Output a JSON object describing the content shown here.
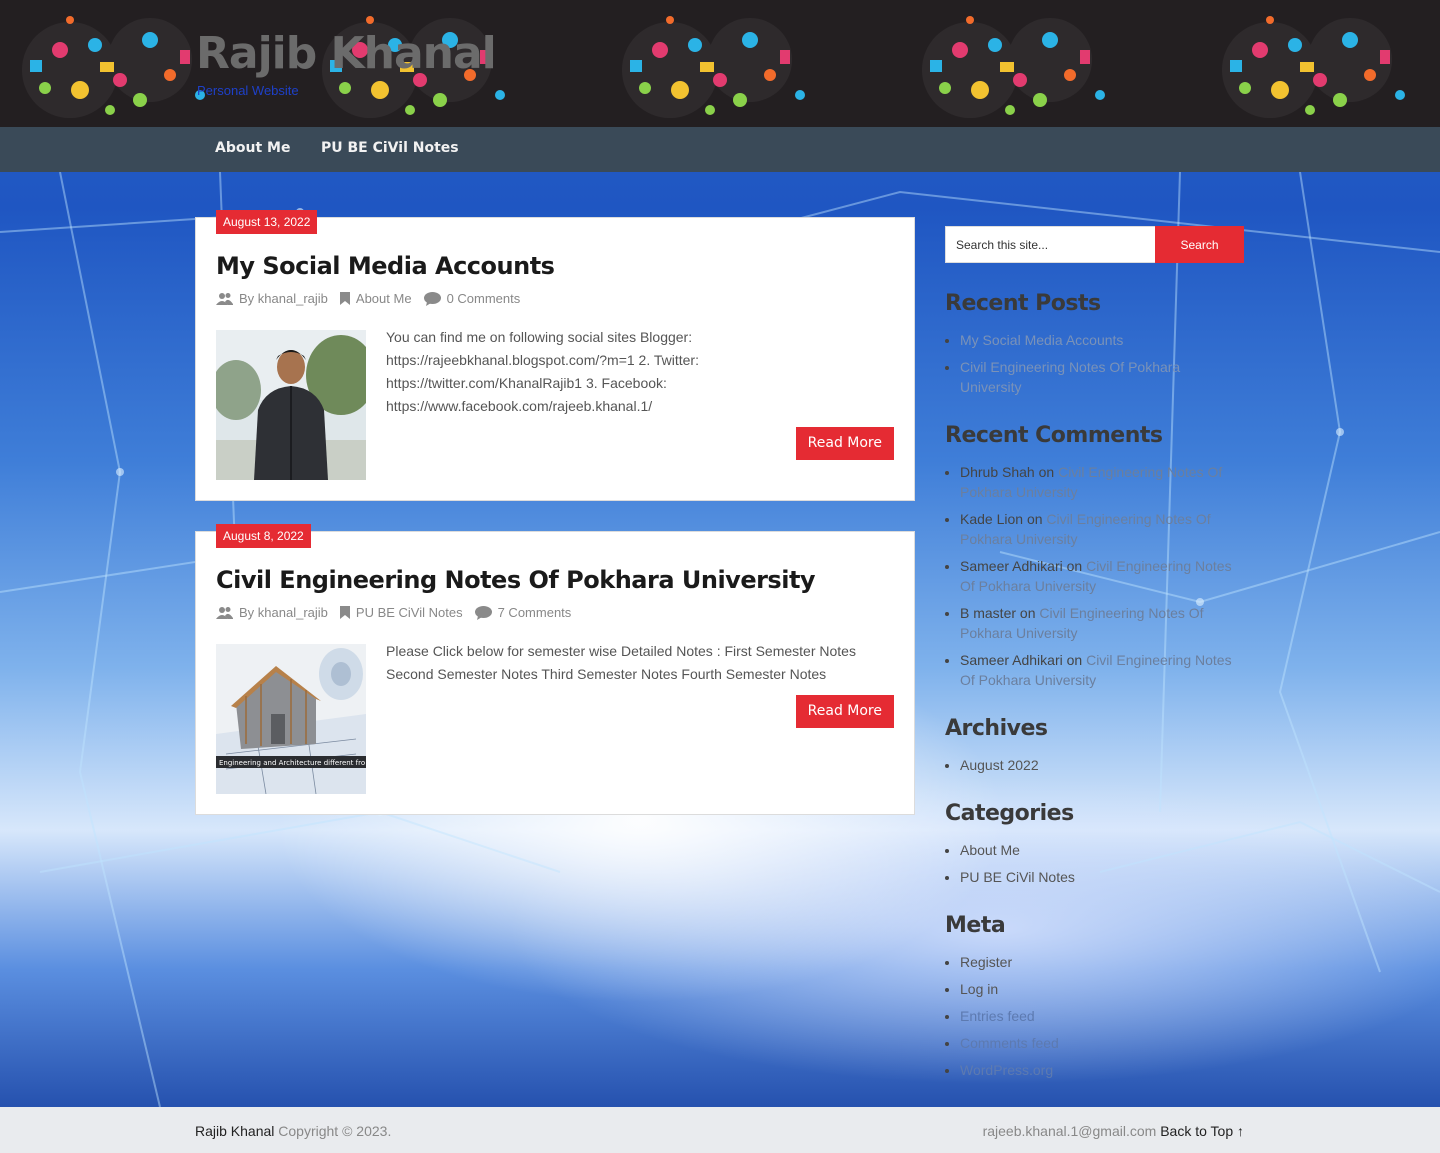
{
  "header": {
    "site_title": "Rajib Khanal",
    "tagline": "Personal Website"
  },
  "nav": {
    "items": [
      {
        "label": "About Me"
      },
      {
        "label": "PU BE CiVil Notes"
      }
    ]
  },
  "posts": [
    {
      "date": "August 13, 2022",
      "title": "My Social Media Accounts",
      "author_prefix": "By",
      "author": "khanal_rajib",
      "category": "About Me",
      "comments": "0 Comments",
      "excerpt": "You can find me on following social sites Blogger: https://rajeebkhanal.blogspot.com/?m=1 2. Twitter: https://twitter.com/KhanalRajib1 3. Facebook: https://www.facebook.com/rajeeb.khanal.1/",
      "read_more": "Read More"
    },
    {
      "date": "August 8, 2022",
      "title": "Civil Engineering Notes Of Pokhara University",
      "author_prefix": "By",
      "author": "khanal_rajib",
      "category": "PU BE CiVil Notes",
      "comments": "7 Comments",
      "excerpt": "Please Click below for semester wise Detailed Notes : First Semester Notes Second Semester Notes Third Semester Notes Fourth Semester Notes",
      "read_more": "Read More",
      "thumb_caption": "Engineering and Architecture different fro"
    }
  ],
  "sidebar": {
    "search": {
      "placeholder": "Search this site...",
      "button": "Search"
    },
    "recent_posts": {
      "title": "Recent Posts",
      "items": [
        "My Social Media Accounts",
        "Civil Engineering Notes Of Pokhara University"
      ]
    },
    "recent_comments": {
      "title": "Recent Comments",
      "on": "on",
      "items": [
        {
          "author": "Dhrub Shah",
          "post": "Civil Engineering Notes Of Pokhara University"
        },
        {
          "author": "Kade Lion",
          "post": "Civil Engineering Notes Of Pokhara University"
        },
        {
          "author": "Sameer Adhikari",
          "post": "Civil Engineering Notes Of Pokhara University"
        },
        {
          "author": "B master",
          "post": "Civil Engineering Notes Of Pokhara University"
        },
        {
          "author": "Sameer Adhikari",
          "post": "Civil Engineering Notes Of Pokhara University"
        }
      ]
    },
    "archives": {
      "title": "Archives",
      "items": [
        "August 2022"
      ]
    },
    "categories": {
      "title": "Categories",
      "items": [
        "About Me",
        "PU BE CiVil Notes"
      ]
    },
    "meta": {
      "title": "Meta",
      "items": [
        "Register",
        "Log in",
        "Entries feed",
        "Comments feed",
        "WordPress.org"
      ]
    }
  },
  "footer": {
    "brand": "Rajib Khanal",
    "copyright": "Copyright © 2023.",
    "email": "rajeeb.khanal.1@gmail.com",
    "back_to_top": "Back to Top ↑"
  },
  "colors": {
    "accent": "#e52b33",
    "nav_bg": "#3a4a58",
    "header_bg": "#1d1a1c",
    "footer_bg": "#e9ebee"
  }
}
